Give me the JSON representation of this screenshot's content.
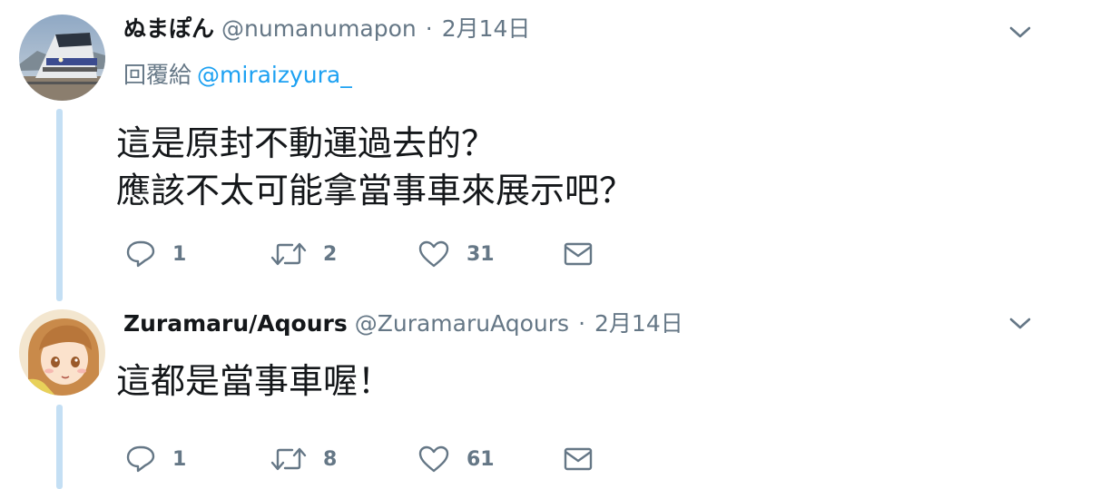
{
  "tweets": [
    {
      "display_name": "ぬまぽん",
      "handle": "@numanumapon",
      "separator": "·",
      "date": "2月14日",
      "reply_prefix": "回覆給",
      "reply_to": "@miraizyura_",
      "text_lines": [
        "這是原封不動運過去的？",
        "應該不太可能拿當事車來展示吧？"
      ],
      "reply_count": "1",
      "retweet_count": "2",
      "like_count": "31"
    },
    {
      "display_name": "Zuramaru/Aqours",
      "handle": "@ZuramaruAqours",
      "separator": "·",
      "date": "2月14日",
      "text_lines": [
        "這都是當事車喔！"
      ],
      "reply_count": "1",
      "retweet_count": "8",
      "like_count": "61"
    }
  ],
  "colors": {
    "text": "#14171a",
    "muted": "#657786",
    "link": "#1da1f2",
    "thread_line": "#c4dff4"
  },
  "icons": {
    "reply": "reply-icon",
    "retweet": "retweet-icon",
    "like": "heart-icon",
    "dm": "envelope-icon",
    "more": "chevron-down-icon"
  }
}
